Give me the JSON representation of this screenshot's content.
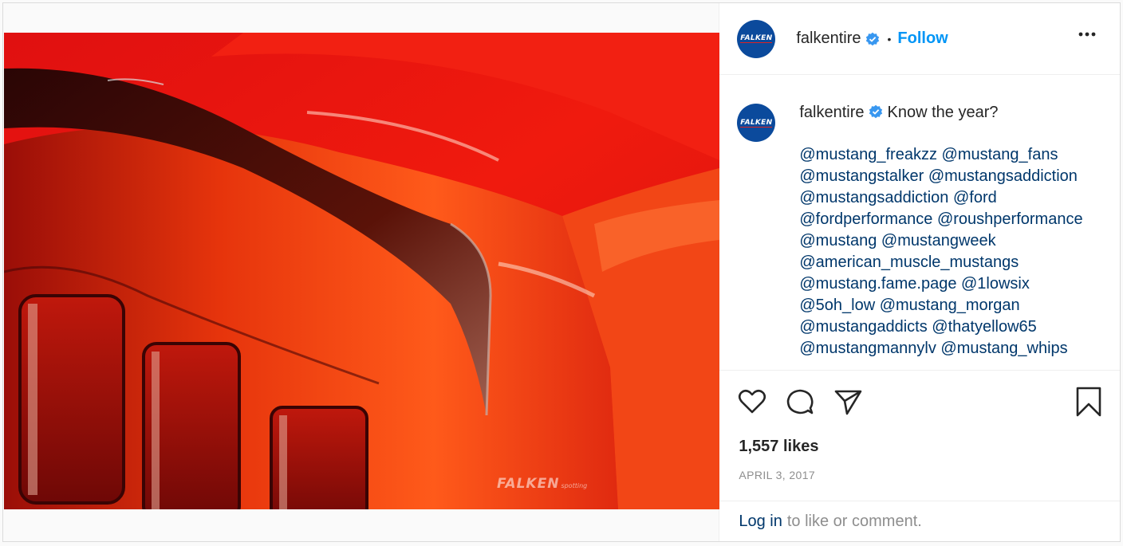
{
  "media": {
    "watermark": "FALKEN",
    "watermark_sub": "spotting"
  },
  "header": {
    "avatar_text": "FALKEN",
    "username": "falkentire",
    "separator": "•",
    "follow_label": "Follow"
  },
  "caption": {
    "username": "falkentire",
    "text": "Know the year?",
    "mentions": [
      "@mustang_freakzz @mustang_fans",
      "@mustangstalker @mustangsaddiction",
      "@mustangsaddiction @ford",
      "@fordperformance @roushperformance",
      "@mustang @mustangweek",
      "@american_muscle_mustangs",
      "@mustang.fame.page @1lowsix",
      "@5oh_low @mustang_morgan",
      "@mustangaddicts @thatyellow65",
      "@mustangmannylv @mustang_whips"
    ]
  },
  "stats": {
    "likes": "1,557 likes",
    "date": "APRIL 3, 2017"
  },
  "login": {
    "link": "Log in",
    "rest": "to like or comment."
  },
  "icons": {
    "like": "heart-icon",
    "comment": "comment-icon",
    "share": "share-icon",
    "save": "bookmark-icon",
    "more": "more-options-icon",
    "verified": "verified-badge-icon"
  },
  "colors": {
    "accent": "#0095f6",
    "link": "#00376b",
    "verified": "#3897f0",
    "brand": "#0b4a9c"
  }
}
